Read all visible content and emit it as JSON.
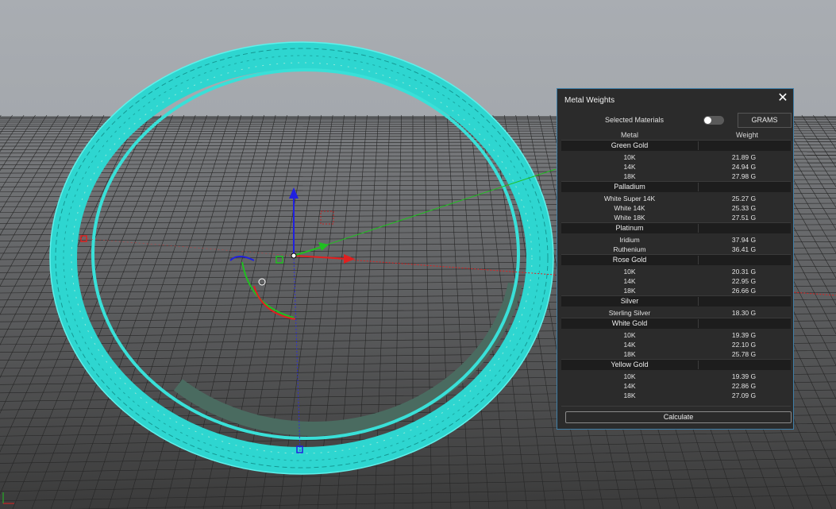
{
  "viewport": {
    "background_top": "#a9adb2",
    "background_bottom": "#3b3b3b",
    "grid_color": "#2a2a2a",
    "model_color": "#2ed6d0",
    "axis_x_color": "#e02020",
    "axis_y_color": "#20c020",
    "axis_z_color": "#2020e0",
    "icons": [
      "gumball-widget",
      "ring-model",
      "world-axis-icon"
    ]
  },
  "panel": {
    "title": "Metal Weights",
    "close_icon": "close-icon",
    "selected_materials_label": "Selected Materials",
    "selected_materials_on": false,
    "unit_button": "GRAMS",
    "col_metal": "Metal",
    "col_weight": "Weight",
    "calculate_label": "Calculate",
    "accent": "#3f7fa8",
    "groups": [
      {
        "name": "Green Gold",
        "rows": [
          {
            "metal": "10K",
            "weight": "21.89 G"
          },
          {
            "metal": "14K",
            "weight": "24.94 G"
          },
          {
            "metal": "18K",
            "weight": "27.98 G"
          }
        ]
      },
      {
        "name": "Palladium",
        "rows": [
          {
            "metal": "White Super 14K",
            "weight": "25.27 G"
          },
          {
            "metal": "White 14K",
            "weight": "25.33 G"
          },
          {
            "metal": "White 18K",
            "weight": "27.51 G"
          }
        ]
      },
      {
        "name": "Platinum",
        "rows": [
          {
            "metal": "Iridium",
            "weight": "37.94 G"
          },
          {
            "metal": "Ruthenium",
            "weight": "36.41 G"
          }
        ]
      },
      {
        "name": "Rose Gold",
        "rows": [
          {
            "metal": "10K",
            "weight": "20.31 G"
          },
          {
            "metal": "14K",
            "weight": "22.95 G"
          },
          {
            "metal": "18K",
            "weight": "26.66 G"
          }
        ]
      },
      {
        "name": "Silver",
        "rows": [
          {
            "metal": "Sterling Silver",
            "weight": "18.30 G"
          }
        ]
      },
      {
        "name": "White Gold",
        "rows": [
          {
            "metal": "10K",
            "weight": "19.39 G"
          },
          {
            "metal": "14K",
            "weight": "22.10 G"
          },
          {
            "metal": "18K",
            "weight": "25.78 G"
          }
        ]
      },
      {
        "name": "Yellow Gold",
        "rows": [
          {
            "metal": "10K",
            "weight": "19.39 G"
          },
          {
            "metal": "14K",
            "weight": "22.86 G"
          },
          {
            "metal": "18K",
            "weight": "27.09 G"
          }
        ]
      }
    ]
  }
}
